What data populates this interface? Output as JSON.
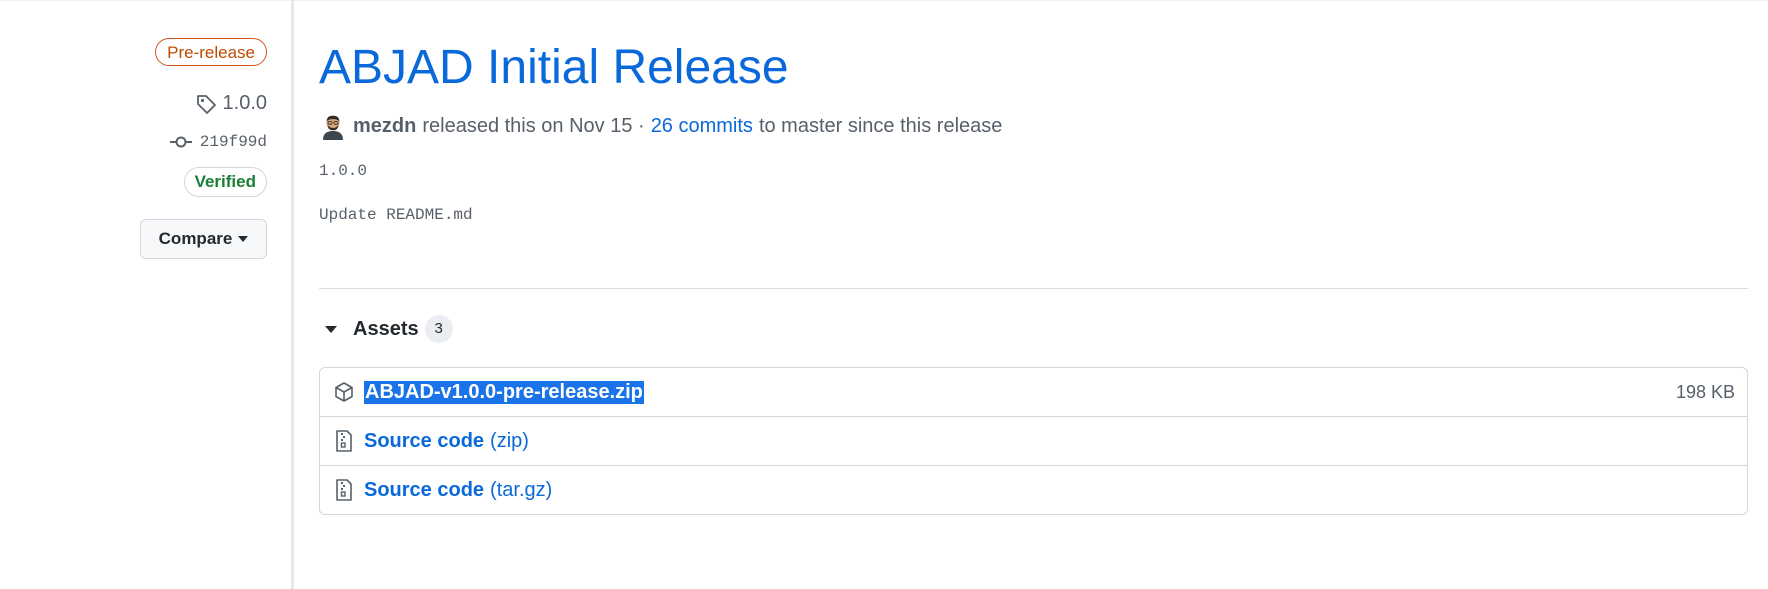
{
  "sidebar": {
    "release_badge": "Pre-release",
    "tag": "1.0.0",
    "commit": "219f99d",
    "verified": "Verified",
    "compare_label": "Compare"
  },
  "release": {
    "title": "ABJAD Initial Release",
    "author": "mezdn",
    "released_text": "released this on Nov 15 ·",
    "commits_link": "26 commits",
    "commits_suffix": "to master since this release",
    "body_lines": [
      "1.0.0",
      "Update README.md"
    ]
  },
  "assets": {
    "label": "Assets",
    "count": "3",
    "items": [
      {
        "name": "ABJAD-v1.0.0-pre-release.zip",
        "size": "198 KB",
        "icon": "package-icon"
      },
      {
        "label": "Source code",
        "ext": "(zip)",
        "icon": "file-zip-icon"
      },
      {
        "label": "Source code",
        "ext": "(tar.gz)",
        "icon": "file-zip-icon"
      }
    ]
  },
  "colors": {
    "link": "#0969da",
    "prerelease": "#bc4c00",
    "verified": "#1a7f37",
    "selection": "#1a73e8"
  }
}
